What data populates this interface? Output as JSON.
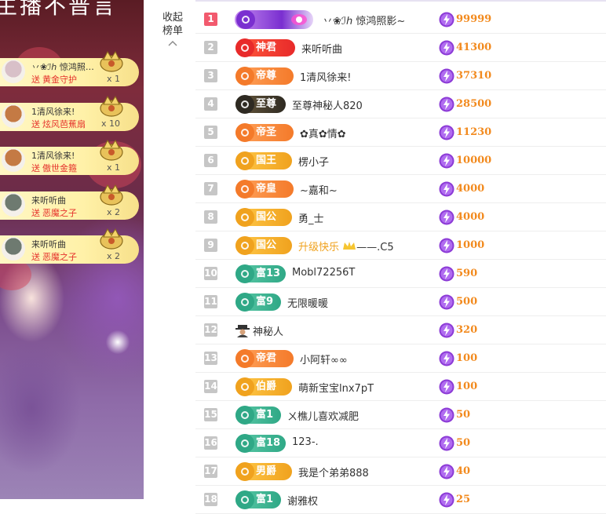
{
  "stream": {
    "title": "主播不普言"
  },
  "gift_feed": [
    {
      "sender": "丷❀ℐℎ 惊鸿照影~",
      "verb": "送",
      "gift": "黄金守护",
      "count": "x 1",
      "avatar_color": "#d8c0c8",
      "gift_icon": "golden-guard-icon"
    },
    {
      "sender": "1清风徐来!",
      "verb": "送",
      "gift": "炫风芭蕉扇",
      "count": "x 10",
      "avatar_color": "#c47a44",
      "gift_icon": "fan-icon"
    },
    {
      "sender": "1清风徐来!",
      "verb": "送",
      "gift": "傲世金箍",
      "count": "x 1",
      "avatar_color": "#c47a44",
      "gift_icon": "golden-staff-icon"
    },
    {
      "sender": "来听听曲",
      "verb": "送",
      "gift": "恶魔之子",
      "count": "x 2",
      "avatar_color": "#6e7a70",
      "gift_icon": "demon-car-icon"
    },
    {
      "sender": "来听听曲",
      "verb": "送",
      "gift": "恶魔之子",
      "count": "x 2",
      "avatar_color": "#6e7a70",
      "gift_icon": "demon-car-icon"
    }
  ],
  "rank": {
    "collapse_label": "收起榜单",
    "rows": [
      {
        "num": "1",
        "badge": "",
        "badge_colors": [
          "#b078e8",
          "#8d3bd6"
        ],
        "name": "丷❀ℐℎ 惊鸿照影~",
        "name_style": "normal",
        "amount": "99999"
      },
      {
        "num": "2",
        "badge": "神君",
        "badge_colors": [
          "#ff5a3c",
          "#e82a2a"
        ],
        "name": "来听听曲",
        "name_style": "normal",
        "amount": "41300"
      },
      {
        "num": "3",
        "badge": "帝尊",
        "badge_colors": [
          "#ffa35c",
          "#f47a2a"
        ],
        "name": "1清风徐来!",
        "name_style": "normal",
        "amount": "37310"
      },
      {
        "num": "4",
        "badge": "至尊",
        "badge_colors": [
          "#6a5a3c",
          "#2e2a22"
        ],
        "name": "至尊神秘人820",
        "name_style": "normal",
        "amount": "28500"
      },
      {
        "num": "5",
        "badge": "帝圣",
        "badge_colors": [
          "#ffa35c",
          "#f47a2a"
        ],
        "name": "✿真✿情✿",
        "name_style": "normal",
        "amount": "11230"
      },
      {
        "num": "6",
        "badge": "国王",
        "badge_colors": [
          "#ffc94a",
          "#f0a21e"
        ],
        "name": "楞小子",
        "name_style": "normal",
        "amount": "10000"
      },
      {
        "num": "7",
        "badge": "帝皇",
        "badge_colors": [
          "#ffa35c",
          "#f47a2a"
        ],
        "name": "~嘉和~",
        "name_style": "normal",
        "amount": "4000"
      },
      {
        "num": "8",
        "badge": "国公",
        "badge_colors": [
          "#ffc94a",
          "#f0a21e"
        ],
        "name": "勇_士",
        "name_style": "normal",
        "amount": "4000"
      },
      {
        "num": "9",
        "badge": "国公",
        "badge_colors": [
          "#ffc94a",
          "#f0a21e"
        ],
        "name": "升级快乐",
        "name_suffix": "——.C5",
        "name_style": "gold",
        "amount": "1000"
      },
      {
        "num": "10",
        "badge": "富13",
        "badge_colors": [
          "#5ccaa8",
          "#2fa886"
        ],
        "name": "Mobl72256T",
        "name_style": "normal",
        "amount": "590"
      },
      {
        "num": "11",
        "badge": "富9",
        "badge_colors": [
          "#5ccaa8",
          "#2fa886"
        ],
        "name": "无限暖暖",
        "name_style": "normal",
        "amount": "500"
      },
      {
        "num": "12",
        "badge": "",
        "badge_colors": [],
        "name": "神秘人",
        "name_style": "mystery",
        "amount": "320"
      },
      {
        "num": "13",
        "badge": "帝君",
        "badge_colors": [
          "#ffa35c",
          "#f47a2a"
        ],
        "name": "小阿轩∞∞",
        "name_style": "normal",
        "amount": "100"
      },
      {
        "num": "14",
        "badge": "伯爵",
        "badge_colors": [
          "#ffc94a",
          "#f0a21e"
        ],
        "name": "萌新宝宝lnx7pT",
        "name_style": "normal",
        "amount": "100"
      },
      {
        "num": "15",
        "badge": "富1",
        "badge_colors": [
          "#5ccaa8",
          "#2fa886"
        ],
        "name": "ㄨ樵儿喜欢减肥",
        "name_style": "normal",
        "amount": "50"
      },
      {
        "num": "16",
        "badge": "富18",
        "badge_colors": [
          "#5ccaa8",
          "#2fa886"
        ],
        "name": "123-.",
        "name_style": "normal",
        "amount": "50"
      },
      {
        "num": "17",
        "badge": "男爵",
        "badge_colors": [
          "#ffc94a",
          "#f0a21e"
        ],
        "name": "我是个弟弟888",
        "name_style": "normal",
        "amount": "40"
      },
      {
        "num": "18",
        "badge": "富1",
        "badge_colors": [
          "#5ccaa8",
          "#2fa886"
        ],
        "name": "谢雅权",
        "name_style": "normal",
        "amount": "25"
      }
    ]
  },
  "icons": {
    "coin": "lightning-coin-icon",
    "collapse": "chevron-up-icon",
    "mystery": "mystery-man-icon"
  },
  "colors": {
    "amount": "#f28a1e",
    "rank_first": "#f25a6e",
    "rank_default": "#c6c6c6",
    "gift_verb": "#e5312b"
  }
}
